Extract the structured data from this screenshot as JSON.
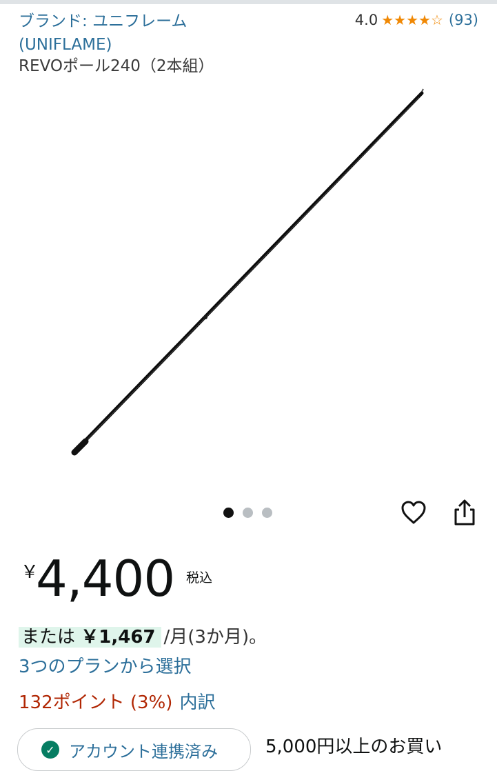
{
  "brand": {
    "prefix": "ブランド: ",
    "name": "ユニフレーム (UNIFLAME)"
  },
  "rating": {
    "value": "4.0",
    "stars": 4.0,
    "star_full": "★",
    "star_empty": "☆",
    "count": "(93)",
    "star_color": "#f08804"
  },
  "product": {
    "title": "REVOポール240（2本組）"
  },
  "image": {
    "count": 3,
    "active": 0
  },
  "actions": {
    "favorite_icon": "heart-outline-icon",
    "share_icon": "share-icon"
  },
  "price": {
    "currency": "￥",
    "amount": "4,400",
    "tax_label": "税込"
  },
  "installment": {
    "prefix": "または ",
    "amount": "￥1,467",
    "suffix": "/月(3か月)。",
    "highlight_color": "#dff5eb"
  },
  "plan_link": {
    "label": "3つのプランから選択"
  },
  "points": {
    "value": "132ポイント (3%)",
    "breakdown_label": "内訳"
  },
  "account": {
    "label": "アカウント連携済み"
  },
  "shipping": {
    "label": "5,000円以上のお買い"
  },
  "colors": {
    "link": "#2c6f9a",
    "points": "#b12704",
    "check": "#067d62"
  }
}
